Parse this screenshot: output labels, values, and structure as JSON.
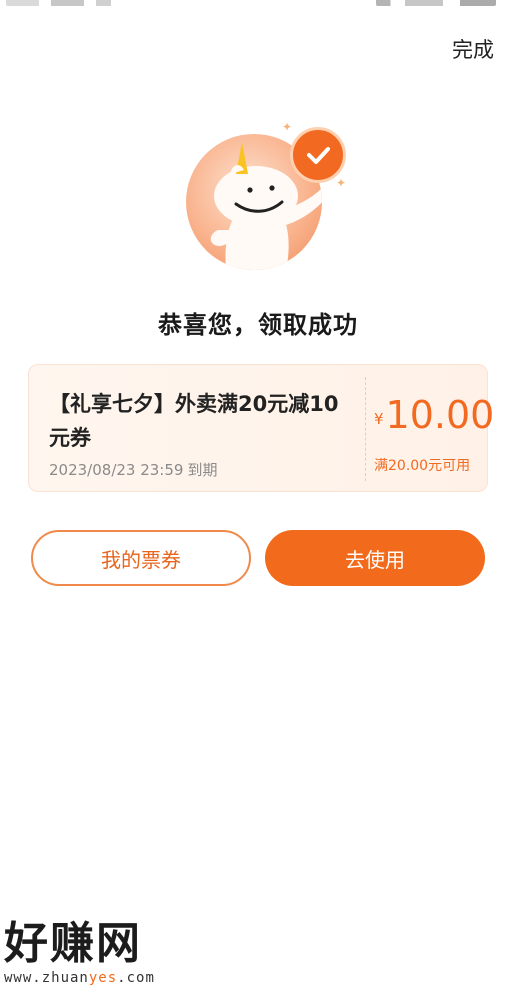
{
  "header": {
    "done_label": "完成"
  },
  "success": {
    "title": "恭喜您，领取成功"
  },
  "coupon": {
    "title": "【礼享七夕】外卖满20元减10元券",
    "expiry_date": "2023/08/23 23:59",
    "expiry_suffix": "到期",
    "currency": "¥",
    "amount": "10.00",
    "condition": "满20.00元可用"
  },
  "actions": {
    "my_tickets_label": "我的票券",
    "use_label": "去使用"
  },
  "watermark": {
    "logo_text": "好赚网",
    "url_prefix": "www.zhuan",
    "url_accent": "yes",
    "url_suffix": ".com"
  },
  "colors": {
    "accent": "#f26a1b",
    "coupon_bg": "#fff4ec"
  },
  "icons": {
    "badge": "check-icon",
    "hero": "unicorn-mascot"
  }
}
